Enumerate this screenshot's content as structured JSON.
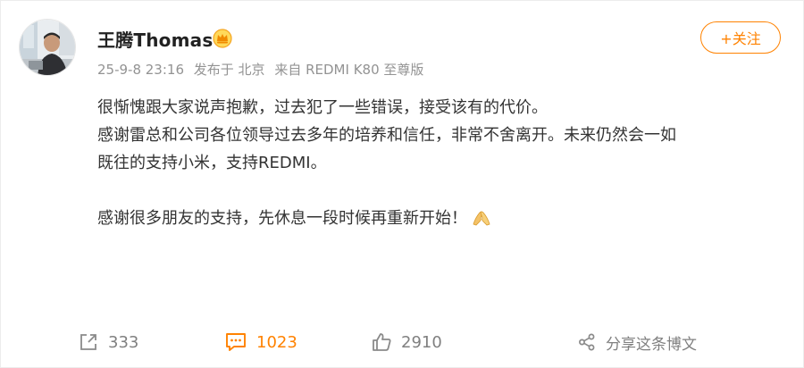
{
  "post": {
    "author": {
      "name": "王腾Thomas",
      "avatar": "avatar-photo",
      "badge": "crown-badge-icon"
    },
    "meta": {
      "date": "25-9-8 23:16",
      "location": "发布于 北京",
      "source": "来自 REDMI K80 至尊版"
    },
    "follow_label": "+关注",
    "paragraphs": [
      "很惭愧跟大家说声抱歉，过去犯了一些错误，接受该有的代价。",
      "感谢雷总和公司各位领导过去多年的培养和信任，非常不舍离开。未来仍然会一如",
      "既往的支持小米，支持REDMI。",
      "",
      "感谢很多朋友的支持，先休息一段时候再重新开始！"
    ],
    "emoji": "praying-hands-emoji"
  },
  "actions": {
    "repost": {
      "icon": "repost-icon",
      "count": "333"
    },
    "comment": {
      "icon": "comment-icon",
      "count": "1023"
    },
    "like": {
      "icon": "thumbs-up-icon",
      "count": "2910"
    },
    "share": {
      "icon": "share-icon",
      "label": "分享这条博文"
    }
  },
  "colors": {
    "accent": "#ff8200",
    "meta_text": "#939393",
    "body_text": "#333333",
    "action_text": "#808080"
  }
}
